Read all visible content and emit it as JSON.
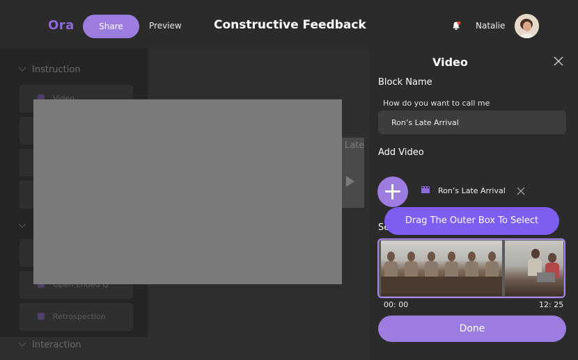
{
  "header": {
    "logo": "Ora",
    "share_label": "Share",
    "preview_label": "Preview",
    "title": "Constructive Feedback",
    "user_name": "Natalie",
    "notification_dot_color": "#e0473f"
  },
  "sidebar": {
    "section_instruction": "Instruction",
    "item_video": "Video",
    "item_open_ended": "Open Ended Q",
    "item_retrospection": "Retrospection",
    "section_interaction": "Interaction"
  },
  "background_block": {
    "label": "Late"
  },
  "panel": {
    "title": "Video",
    "block_name_label": "Block Name",
    "block_name_hint": "How do you want to call me",
    "block_name_value": "Ron’s Late Arrival",
    "add_video_label": "Add Video",
    "video_file_name": "Ron’s Late Arrival",
    "select_label_partial": "Se",
    "tooltip": "Drag The Outer Box To Select",
    "time_start": "00: 00",
    "time_end": "12: 25",
    "done_label": "Done",
    "accent_color": "#9d7ce0",
    "tooltip_color": "#7d5ef0"
  }
}
